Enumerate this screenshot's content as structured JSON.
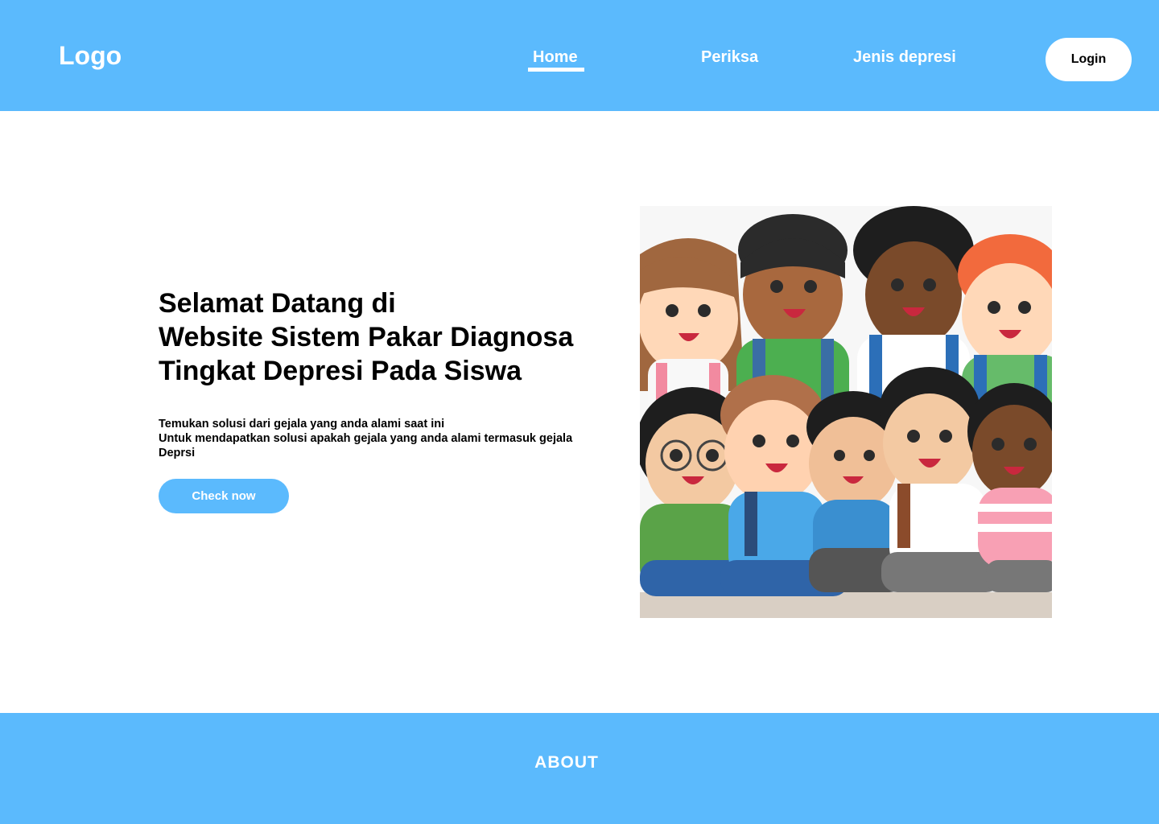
{
  "header": {
    "logo": "Logo",
    "nav": [
      {
        "label": "Home",
        "active": true
      },
      {
        "label": "Periksa",
        "active": false
      },
      {
        "label": "Jenis depresi",
        "active": false
      }
    ],
    "login_label": "Login"
  },
  "hero": {
    "title_lines": [
      "Selamat Datang di",
      "Website Sistem Pakar Diagnosa",
      "Tingkat Depresi Pada Siswa"
    ],
    "description_lines": [
      "Temukan solusi dari gejala yang anda alami saat ini",
      "Untuk mendapatkan solusi apakah gejala yang anda alami termasuk gejala Deprsi"
    ],
    "cta_label": "Check now",
    "illustration": "group-of-smiling-students-illustration"
  },
  "footer": {
    "about_label": "ABOUT"
  },
  "colors": {
    "primary": "#5bbafd",
    "background": "#ffffff",
    "text": "#000000"
  }
}
